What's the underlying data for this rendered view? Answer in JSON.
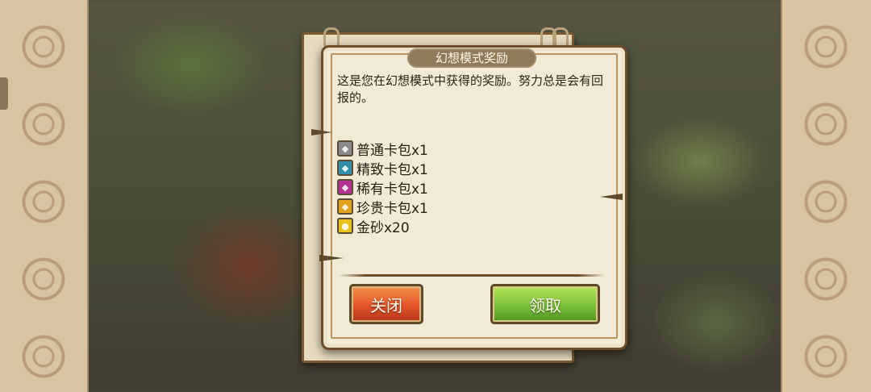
{
  "dialog": {
    "title": "幻想模式奖励",
    "description": "这是您在幻想模式中获得的奖励。努力总是会有回报的。",
    "rewards": [
      {
        "label": "普通卡包x1",
        "icon": "common-card-pack-icon",
        "color": "#8a8a8a"
      },
      {
        "label": "精致卡包x1",
        "icon": "fine-card-pack-icon",
        "color": "#2f8fa8"
      },
      {
        "label": "稀有卡包x1",
        "icon": "rare-card-pack-icon",
        "color": "#b3328f"
      },
      {
        "label": "珍贵卡包x1",
        "icon": "precious-card-pack-icon",
        "color": "#e0a21c"
      },
      {
        "label": "金砂x20",
        "icon": "gold-sand-icon",
        "color": "#e8c21a"
      }
    ],
    "buttons": {
      "close_label": "关闭",
      "claim_label": "领取"
    }
  },
  "colors": {
    "close_button": "#e2532a",
    "claim_button": "#7bc23a",
    "panel": "#f1ead6",
    "frame": "#6e4e2a"
  }
}
